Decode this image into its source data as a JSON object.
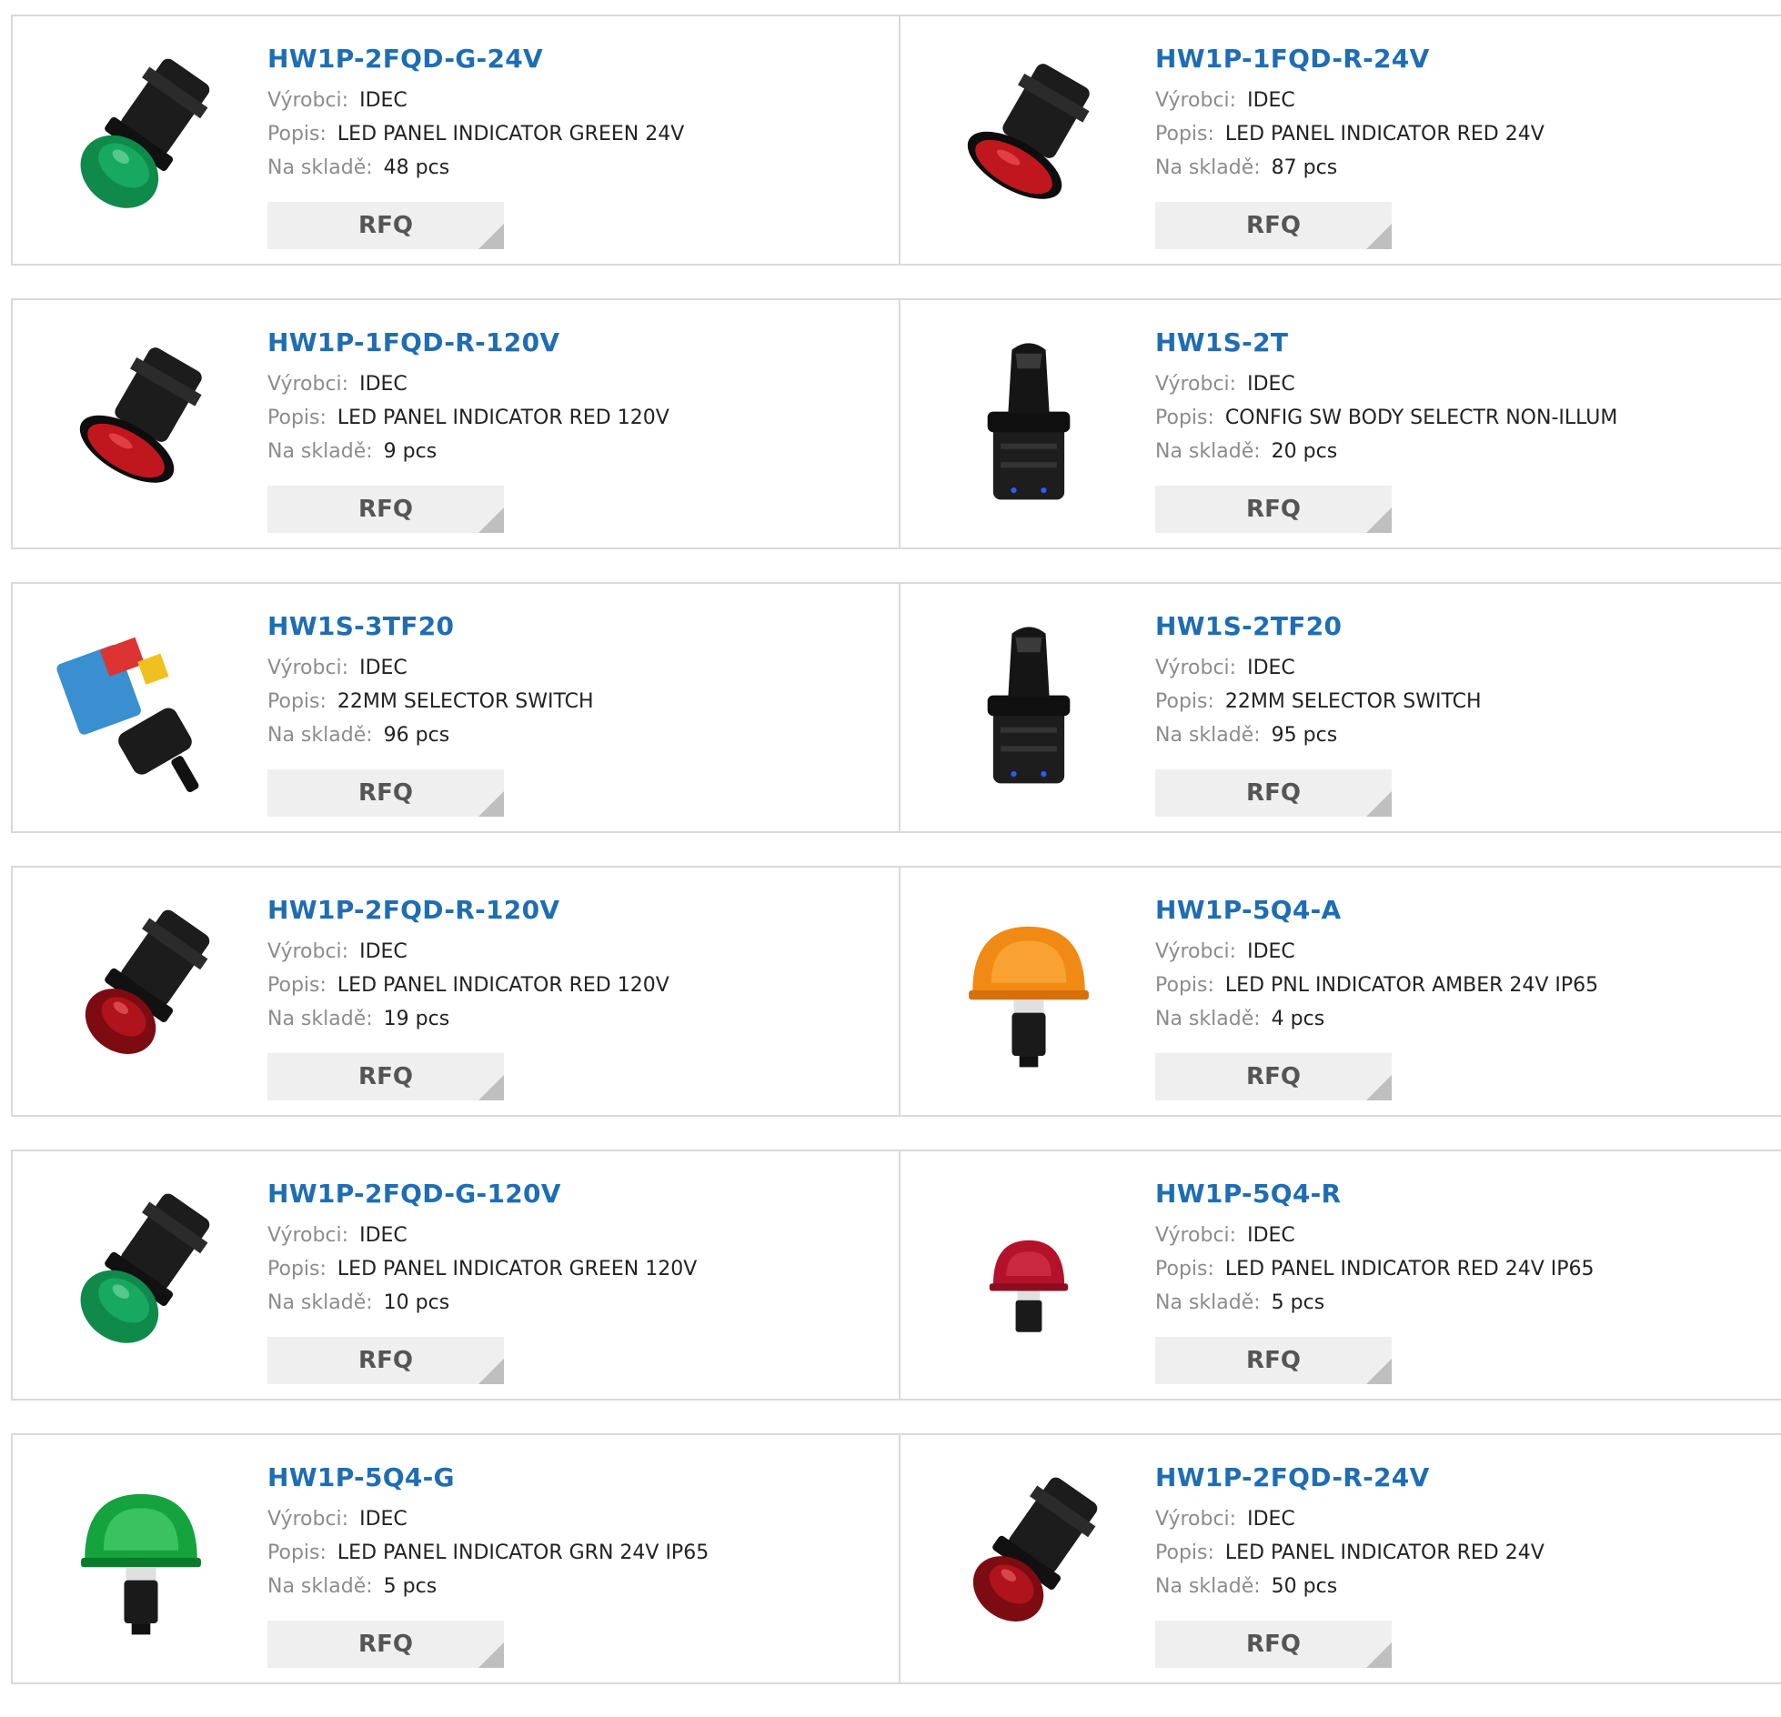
{
  "labels": {
    "manufacturer": "Výrobci:",
    "description": "Popis:",
    "stock": "Na skladě:",
    "rfq": "RFQ"
  },
  "colors": {
    "title": "#1f6db3",
    "label": "#8c8c8c",
    "button_bg": "#efefef",
    "border": "#d9d9d9"
  },
  "products": [
    {
      "part": "HW1P-2FQD-G-24V",
      "manufacturer": "IDEC",
      "description": "LED PANEL INDICATOR GREEN 24V",
      "stock": "48 pcs",
      "image": "green-dome-indicator-icon"
    },
    {
      "part": "HW1P-1FQD-R-24V",
      "manufacturer": "IDEC",
      "description": "LED PANEL INDICATOR RED 24V",
      "stock": "87 pcs",
      "image": "red-flat-indicator-icon"
    },
    {
      "part": "HW1P-1FQD-R-120V",
      "manufacturer": "IDEC",
      "description": "LED PANEL INDICATOR RED 120V",
      "stock": "9 pcs",
      "image": "red-flat-indicator-icon"
    },
    {
      "part": "HW1S-2T",
      "manufacturer": "IDEC",
      "description": "CONFIG SW BODY SELECTR NON-ILLUM",
      "stock": "20 pcs",
      "image": "selector-switch-icon"
    },
    {
      "part": "HW1S-3TF20",
      "manufacturer": "IDEC",
      "description": "22MM SELECTOR SWITCH",
      "stock": "96 pcs",
      "image": "selector-switch-assembly-icon"
    },
    {
      "part": "HW1S-2TF20",
      "manufacturer": "IDEC",
      "description": "22MM SELECTOR SWITCH",
      "stock": "95 pcs",
      "image": "selector-switch-icon"
    },
    {
      "part": "HW1P-2FQD-R-120V",
      "manufacturer": "IDEC",
      "description": "LED PANEL INDICATOR RED 120V",
      "stock": "19 pcs",
      "image": "red-dome-indicator-icon"
    },
    {
      "part": "HW1P-5Q4-A",
      "manufacturer": "IDEC",
      "description": "LED PNL INDICATOR AMBER 24V IP65",
      "stock": "4 pcs",
      "image": "amber-beacon-icon"
    },
    {
      "part": "HW1P-2FQD-G-120V",
      "manufacturer": "IDEC",
      "description": "LED PANEL INDICATOR GREEN 120V",
      "stock": "10 pcs",
      "image": "green-dome-indicator-icon"
    },
    {
      "part": "HW1P-5Q4-R",
      "manufacturer": "IDEC",
      "description": "LED PANEL INDICATOR RED 24V IP65",
      "stock": "5 pcs",
      "image": "red-beacon-icon"
    },
    {
      "part": "HW1P-5Q4-G",
      "manufacturer": "IDEC",
      "description": "LED PANEL INDICATOR GRN 24V IP65",
      "stock": "5 pcs",
      "image": "green-beacon-icon"
    },
    {
      "part": "HW1P-2FQD-R-24V",
      "manufacturer": "IDEC",
      "description": "LED PANEL INDICATOR RED 24V",
      "stock": "50 pcs",
      "image": "red-dome-indicator-icon"
    }
  ]
}
